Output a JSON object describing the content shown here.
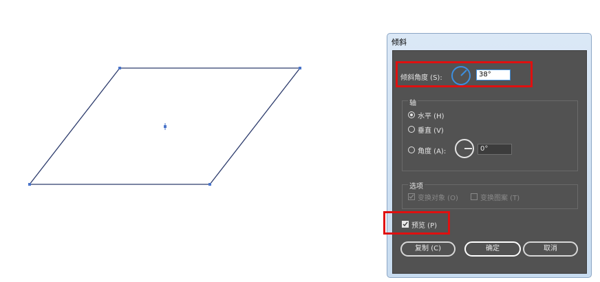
{
  "dialog": {
    "title": "倾斜",
    "skew_angle": {
      "label": "倾斜角度 (S):",
      "value": "38°"
    },
    "axis": {
      "label": "轴",
      "horizontal": "水平 (H)",
      "vertical": "垂直 (V)",
      "angle_label": "角度 (A):",
      "angle_value": "0°",
      "selected": "horizontal"
    },
    "options": {
      "label": "选项",
      "transform_objects": "变换对象 (O)",
      "transform_patterns": "变换图案 (T)",
      "transform_objects_checked": true,
      "transform_patterns_checked": false
    },
    "preview": {
      "label": "预览 (P)",
      "checked": true
    },
    "buttons": {
      "copy": "复制 (C)",
      "ok": "确定",
      "cancel": "取消"
    }
  },
  "colors": {
    "shape_stroke": "#2b3a6b",
    "anchor": "#4a74c9",
    "highlight": "#e01010",
    "dialog_bg": "#525252",
    "dial_accent": "#3d8fe0"
  }
}
